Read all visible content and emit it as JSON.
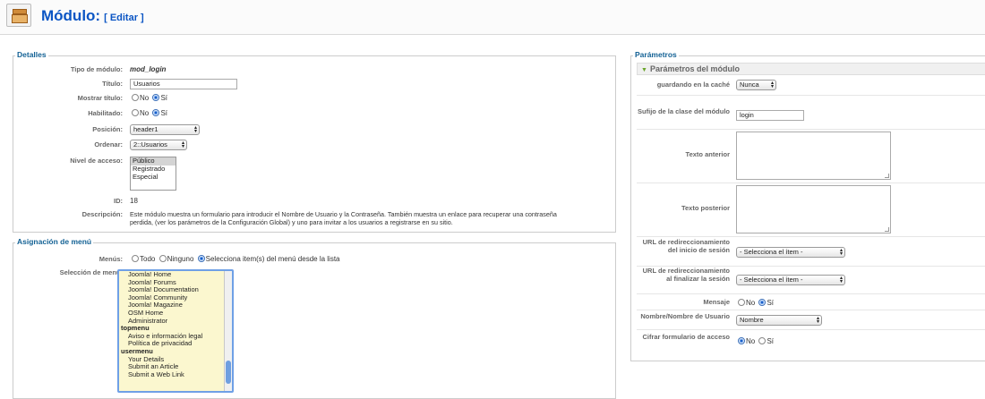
{
  "header": {
    "title": "Módulo:",
    "edit_label": "[ Editar ]"
  },
  "details": {
    "legend": "Detalles",
    "module_type": {
      "label": "Tipo de módulo:",
      "value": "mod_login"
    },
    "title": {
      "label": "Título:",
      "value": "Usuarios"
    },
    "show_title": {
      "label": "Mostrar título:",
      "no": "No",
      "yes": "Sí"
    },
    "enabled": {
      "label": "Habilitado:",
      "no": "No",
      "yes": "Sí"
    },
    "position": {
      "label": "Posición:",
      "value": "header1"
    },
    "order": {
      "label": "Ordenar:",
      "value": "2::Usuarios"
    },
    "access": {
      "label": "Nivel de acceso:",
      "options": [
        "Público",
        "Registrado",
        "Especial"
      ]
    },
    "id": {
      "label": "ID:",
      "value": "18"
    },
    "description": {
      "label": "Descripción:",
      "line1": "Este módulo muestra un formulario para introducir el Nombre de Usuario y la Contraseña. También muestra un enlace para recuperar una contraseña",
      "line2": "perdida, (ver los parámetros de la Configuración Global) y uno para invitar a los usuarios a registrarse en su sitio."
    }
  },
  "menu_assignment": {
    "legend": "Asignación de menú",
    "menus": {
      "label": "Menús:",
      "all": "Todo",
      "none": "Ninguno",
      "select": "Selecciona item(s) del menú desde la lista"
    },
    "selection": {
      "label": "Selección de menú:",
      "items": [
        {
          "text": "Joomla! Home",
          "type": "item"
        },
        {
          "text": "Joomla! Forums",
          "type": "item"
        },
        {
          "text": "Joomla! Documentation",
          "type": "item"
        },
        {
          "text": "Joomla! Community",
          "type": "item"
        },
        {
          "text": "Joomla! Magazine",
          "type": "item"
        },
        {
          "text": "OSM Home",
          "type": "item"
        },
        {
          "text": "Administrator",
          "type": "item"
        },
        {
          "text": "topmenu",
          "type": "group"
        },
        {
          "text": "Aviso e información legal",
          "type": "item"
        },
        {
          "text": "Política de privacidad",
          "type": "item"
        },
        {
          "text": "usermenu",
          "type": "group"
        },
        {
          "text": "Your Details",
          "type": "item"
        },
        {
          "text": "Submit an Article",
          "type": "item"
        },
        {
          "text": "Submit a Web Link",
          "type": "item"
        }
      ]
    }
  },
  "parameters": {
    "legend": "Parámetros",
    "section_title": "Parámetros del módulo",
    "cache": {
      "label": "guardando en la caché",
      "value": "Nunca"
    },
    "suffix": {
      "label": "Sufijo de la clase del módulo",
      "value": "login"
    },
    "pretext": {
      "label": "Texto anterior"
    },
    "posttext": {
      "label": "Texto posterior"
    },
    "login_redirect": {
      "label": "URL de redireccionamiento del inicio de sesión",
      "value": "- Selecciona el ítem -"
    },
    "logout_redirect": {
      "label": "URL de redireccionamiento al finalizar la sesión",
      "value": "- Selecciona el ítem -"
    },
    "greeting": {
      "label": "Mensaje",
      "no": "No",
      "yes": "Sí"
    },
    "name": {
      "label": "Nombre/Nombre de Usuario",
      "value": "Nombre"
    },
    "encrypt": {
      "label": "Cifrar formulario de acceso",
      "no": "No",
      "yes": "Sí"
    }
  }
}
